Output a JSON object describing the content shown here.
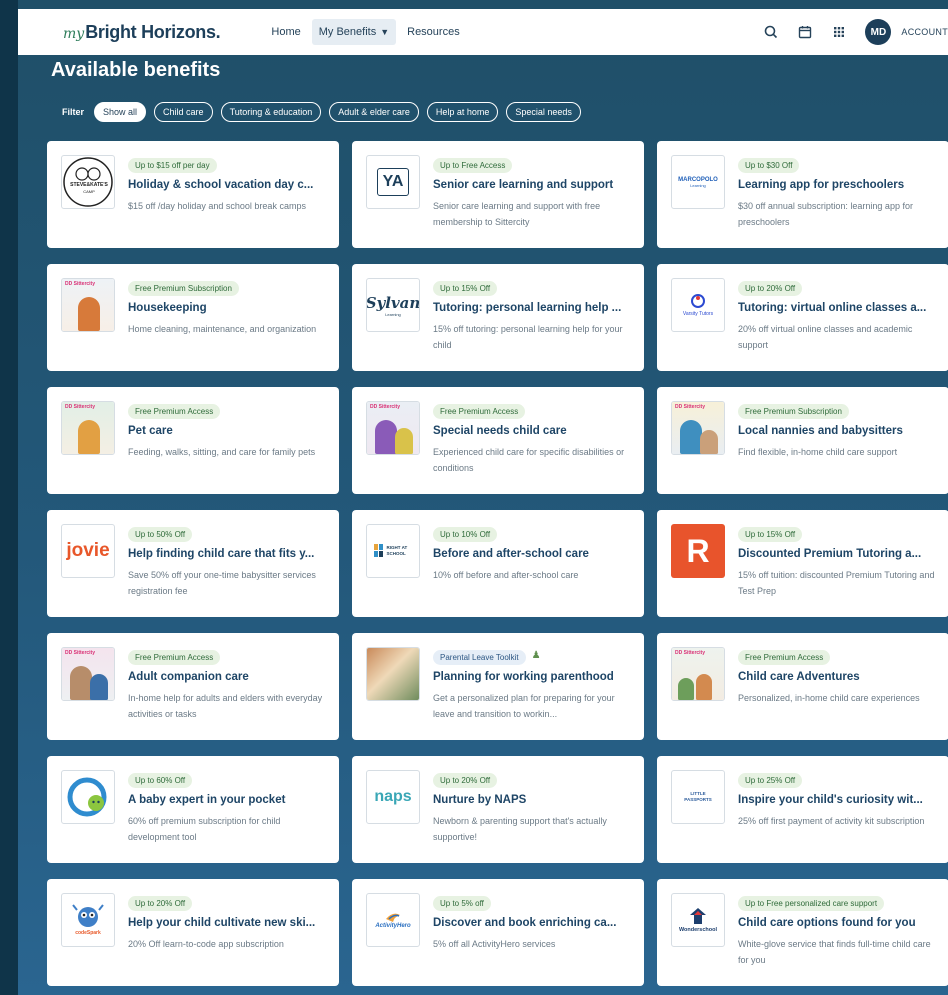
{
  "header": {
    "logo_my": "my",
    "logo_brand": "Bright Horizons.",
    "nav": [
      {
        "label": "Home"
      },
      {
        "label": "My Benefits"
      },
      {
        "label": "Resources"
      }
    ],
    "avatar_initials": "MD",
    "account_label": "ACCOUNT"
  },
  "page_title": "Available benefits",
  "filters": {
    "label": "Filter",
    "chips": [
      "Show all",
      "Child care",
      "Tutoring & education",
      "Adult & elder care",
      "Help at home",
      "Special needs"
    ]
  },
  "cards": [
    {
      "badge": "Up to $15 off per day",
      "title": "Holiday & school vacation day c...",
      "desc": "$15 off /day holiday and school break camps",
      "thumb": "STEVE&KATE'S"
    },
    {
      "badge": "Up to Free Access",
      "title": "Senior care learning and support",
      "desc": "Senior care learning and support with free membership to Sittercity",
      "thumb": "YA"
    },
    {
      "badge": "Up to $30 Off",
      "title": "Learning app for preschoolers",
      "desc": "$30 off annual subscription: learning app for preschoolers",
      "thumb": "MARCOPOLO"
    },
    {
      "badge": "Free Premium Subscription",
      "title": "Housekeeping",
      "desc": "Home cleaning, maintenance, and organization",
      "thumb": "Sittercity"
    },
    {
      "badge": "Up to 15% Off",
      "title": "Tutoring: personal learning help ...",
      "desc": "15% off tutoring: personal learning help for your child",
      "thumb": "Sylvan"
    },
    {
      "badge": "Up to 20% Off",
      "title": "Tutoring: virtual online classes a...",
      "desc": "20% off virtual online classes and academic support",
      "thumb": "Varsity Tutors"
    },
    {
      "badge": "Free Premium Access",
      "title": "Pet care",
      "desc": "Feeding, walks, sitting, and care for family pets",
      "thumb": "Sittercity"
    },
    {
      "badge": "Free Premium Access",
      "title": "Special needs child care",
      "desc": "Experienced child care for specific disabilities or conditions",
      "thumb": "Sittercity"
    },
    {
      "badge": "Free Premium Subscription",
      "title": "Local nannies and babysitters",
      "desc": "Find flexible, in-home child care support",
      "thumb": "Sittercity"
    },
    {
      "badge": "Up to 50% Off",
      "title": "Help finding child care that fits y...",
      "desc": "Save 50% off your one-time babysitter services registration fee",
      "thumb": "jovie"
    },
    {
      "badge": "Up to 10% Off",
      "title": "Before and after-school care",
      "desc": "10% off before and after-school care",
      "thumb": "RIGHT AT SCHOOL"
    },
    {
      "badge": "Up to 15% Off",
      "title": "Discounted Premium Tutoring a...",
      "desc": "15% off tuition: discounted Premium Tutoring and Test Prep",
      "thumb": "R"
    },
    {
      "badge": "Free Premium Access",
      "title": "Adult companion care",
      "desc": "In-home help for adults and elders with everyday activities or tasks",
      "thumb": "Sittercity"
    },
    {
      "badge": "Parental Leave Toolkit",
      "title": "Planning for working parenthood",
      "desc": "Get a personalized plan for preparing for your leave and transition to workin...",
      "thumb": "photo"
    },
    {
      "badge": "Free Premium Access",
      "title": "Child care Adventures",
      "desc": "Personalized, in-home child care experiences",
      "thumb": "Sittercity"
    },
    {
      "badge": "Up to 60% Off",
      "title": "A baby expert in your pocket",
      "desc": "60% off premium subscription for child development tool",
      "thumb": "baby"
    },
    {
      "badge": "Up to 20% Off",
      "title": "Nurture by NAPS",
      "desc": "Newborn & parenting support that's actually supportive!",
      "thumb": "naps"
    },
    {
      "badge": "Up to 25% Off",
      "title": "Inspire your child's curiosity wit...",
      "desc": "25% off first payment of activity kit subscription",
      "thumb": "LITTLE PASSPORTS"
    },
    {
      "badge": "Up to 20% Off",
      "title": "Help your child cultivate new ski...",
      "desc": "20% Off learn-to-code app subscription",
      "thumb": "codeSpark"
    },
    {
      "badge": "Up to 5% off",
      "title": "Discover and book enriching ca...",
      "desc": "5% off all ActivityHero services",
      "thumb": "ActivityHero"
    },
    {
      "badge": "Up to Free personalized care support",
      "title": "Child care options found for you",
      "desc": "White-glove service that finds full-time child care for you",
      "thumb": "Wonderschool"
    }
  ],
  "thumb_labels": {
    "sittercity": "DD Sittercity",
    "steve": "STEVE&KATE'S",
    "steve_sub": "CAMP",
    "ya": "YA",
    "marcopolo": "MARCOPOLO",
    "marcopolo_sub": "Learning",
    "sylvan": "Sylvan",
    "sylvan_sub": "Learning",
    "varsity": "Varsity Tutors",
    "jovie": "jovie",
    "ras": "RIGHT AT SCHOOL",
    "r": "R",
    "naps": "naps",
    "littlepassports": "LITTLE PASSPORTS",
    "activityhero": "ActivityHero",
    "wonderschool": "Wonderschool",
    "codespark": "codeSpark"
  },
  "colors": {
    "accent": "#1e4566",
    "badge_green_bg": "#e7f2e2",
    "background": "#23587a"
  }
}
